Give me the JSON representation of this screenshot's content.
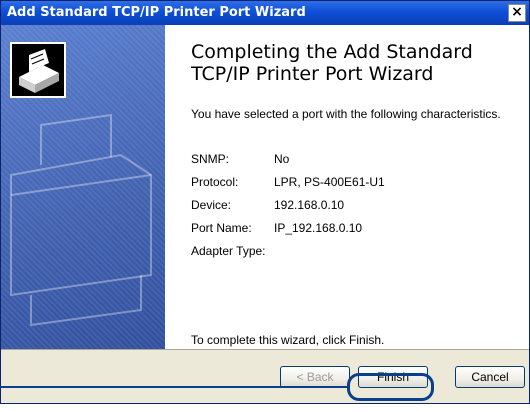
{
  "window": {
    "title": "Add Standard TCP/IP Printer Port Wizard",
    "close_glyph": "×"
  },
  "icons": {
    "wizard_graphic": "printer-wizard-icon",
    "close": "close-icon"
  },
  "main": {
    "heading": "Completing the Add Standard TCP/IP Printer Port Wizard",
    "intro": "You have selected a port with the following characteristics.",
    "properties": [
      {
        "label": "SNMP:",
        "value": "No"
      },
      {
        "label": "Protocol:",
        "value": "LPR, PS-400E61-U1"
      },
      {
        "label": "Device:",
        "value": "192.168.0.10"
      },
      {
        "label": "Port Name:",
        "value": "IP_192.168.0.10"
      },
      {
        "label": "Adapter Type:",
        "value": ""
      }
    ],
    "finish_note": "To complete this wizard, click Finish."
  },
  "footer": {
    "back_label": "< Back",
    "finish_label": "Finish",
    "cancel_label": "Cancel"
  },
  "colors": {
    "titlebar": "#0d4fd6",
    "sidebar": "#4a6cba",
    "highlight": "#0a3f8a"
  }
}
